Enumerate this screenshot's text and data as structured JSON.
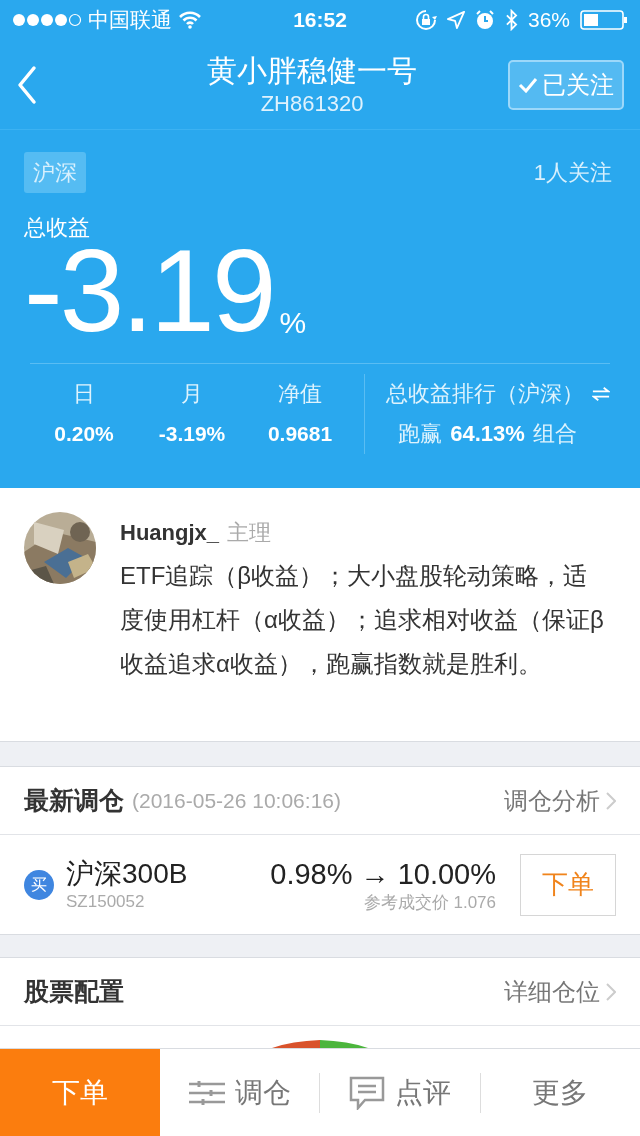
{
  "status_bar": {
    "carrier": "中国联通",
    "time": "16:52",
    "battery": "36%"
  },
  "nav": {
    "title": "黄小胖稳健一号",
    "subtitle": "ZH861320",
    "follow_button": {
      "label": "已关注",
      "followed": true
    }
  },
  "summary": {
    "market_tag": "沪深",
    "followers": "1人关注",
    "total_label": "总收益",
    "total_value": "-3.19",
    "total_unit": "%",
    "stats": [
      {
        "label": "日",
        "value": "0.20%"
      },
      {
        "label": "月",
        "value": "-3.19%"
      },
      {
        "label": "净值",
        "value": "0.9681"
      }
    ],
    "ranking": {
      "label": "总收益排行（沪深）",
      "prefix": "跑赢",
      "value": "64.13%",
      "suffix": "组合"
    }
  },
  "profile": {
    "name": "Huangjx_",
    "role": "主理",
    "description": "ETF追踪（β收益）；大小盘股轮动策略，适度使用杠杆（α收益）；追求相对收益（保证β收益追求α收益），跑赢指数就是胜利。"
  },
  "rebalance": {
    "title": "最新调仓",
    "time": "(2016-05-26 10:06:16)",
    "link": "调仓分析",
    "trades": [
      {
        "action": "买",
        "name": "沪深300B",
        "code": "SZ150052",
        "change": "0.98% → 10.00%",
        "price_note": "参考成交价 1.076",
        "button": "下单"
      }
    ]
  },
  "allocation": {
    "title": "股票配置",
    "link": "详细仓位"
  },
  "bottom_bar": [
    {
      "label": "下单",
      "kind": "primary"
    },
    {
      "label": "调仓",
      "kind": "tab"
    },
    {
      "label": "点评",
      "kind": "tab"
    },
    {
      "label": "更多",
      "kind": "tab"
    }
  ]
}
